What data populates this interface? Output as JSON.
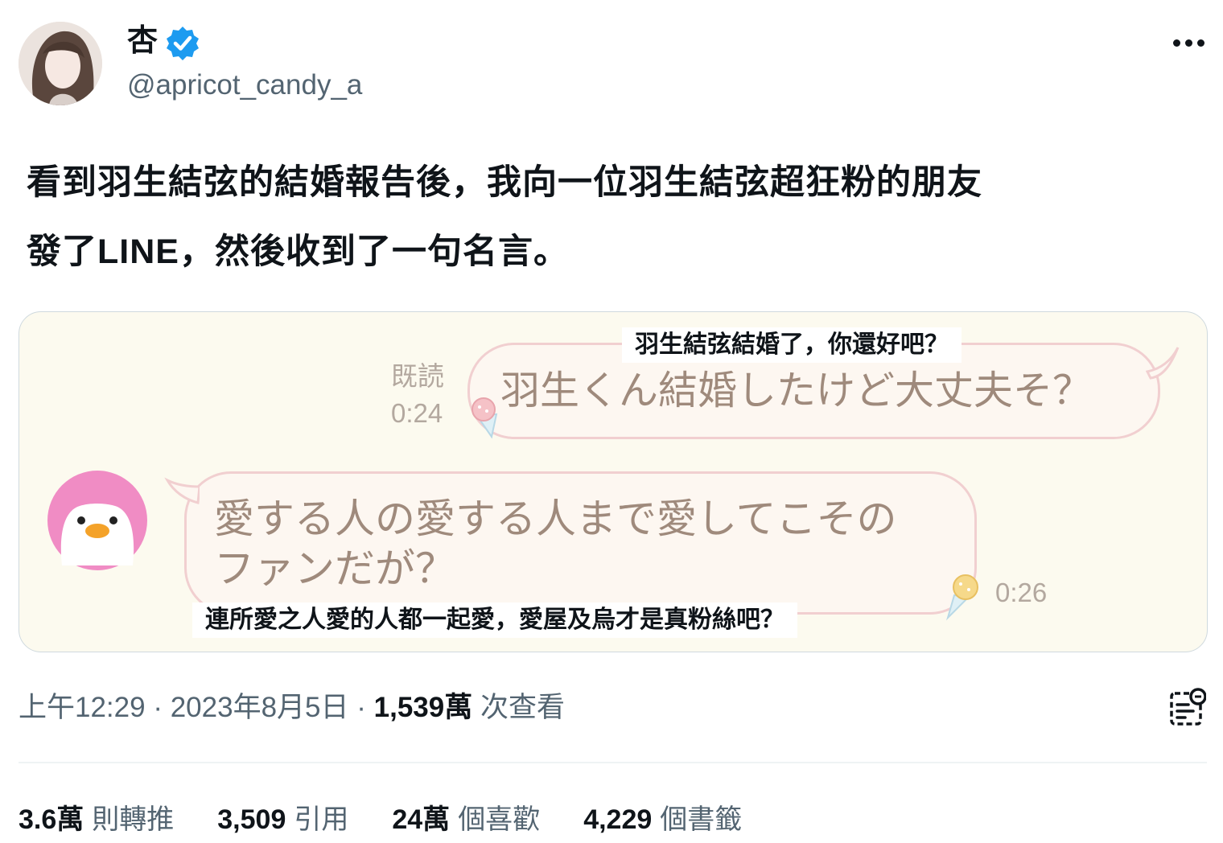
{
  "author": {
    "display_name": "杏",
    "handle": "@apricot_candy_a",
    "verified": true
  },
  "tweet": {
    "text_line1": "看到羽生結弦的結婚報告後，我向一位羽生結弦超狂粉的朋友",
    "text_line2": "發了LINE，然後收到了一句名言。"
  },
  "media": {
    "outgoing_message": "羽生くん結婚したけど大丈夫そ？",
    "outgoing_read": "既読",
    "outgoing_time": "0:24",
    "outgoing_caption": "羽生結弦結婚了，你還好吧？",
    "incoming_message_line1": "愛する人の愛する人まで愛してこその",
    "incoming_message_line2": "ファンだが？",
    "incoming_time": "0:26",
    "incoming_caption": "連所愛之人愛的人都一起愛，愛屋及烏才是真粉絲吧？"
  },
  "meta": {
    "time": "上午12:29",
    "separator": "·",
    "date": "2023年8月5日",
    "views_count": "1,539萬",
    "views_label": "次查看"
  },
  "stats": [
    {
      "count": "3.6萬",
      "label": "則轉推"
    },
    {
      "count": "3,509",
      "label": "引用"
    },
    {
      "count": "24萬",
      "label": "個喜歡"
    },
    {
      "count": "4,229",
      "label": "個書籤"
    }
  ],
  "colors": {
    "verified_blue": "#1d9bf0",
    "secondary_text": "#536471",
    "bubble_border": "#f1cfd0",
    "bubble_text": "#9f8a7c",
    "penguin_pink": "#f08cc4"
  },
  "icons": [
    "verified-badge-icon",
    "more-options-icon",
    "penguin-avatar-icon",
    "ice-cream-sticker-icon",
    "view-analytics-icon"
  ]
}
